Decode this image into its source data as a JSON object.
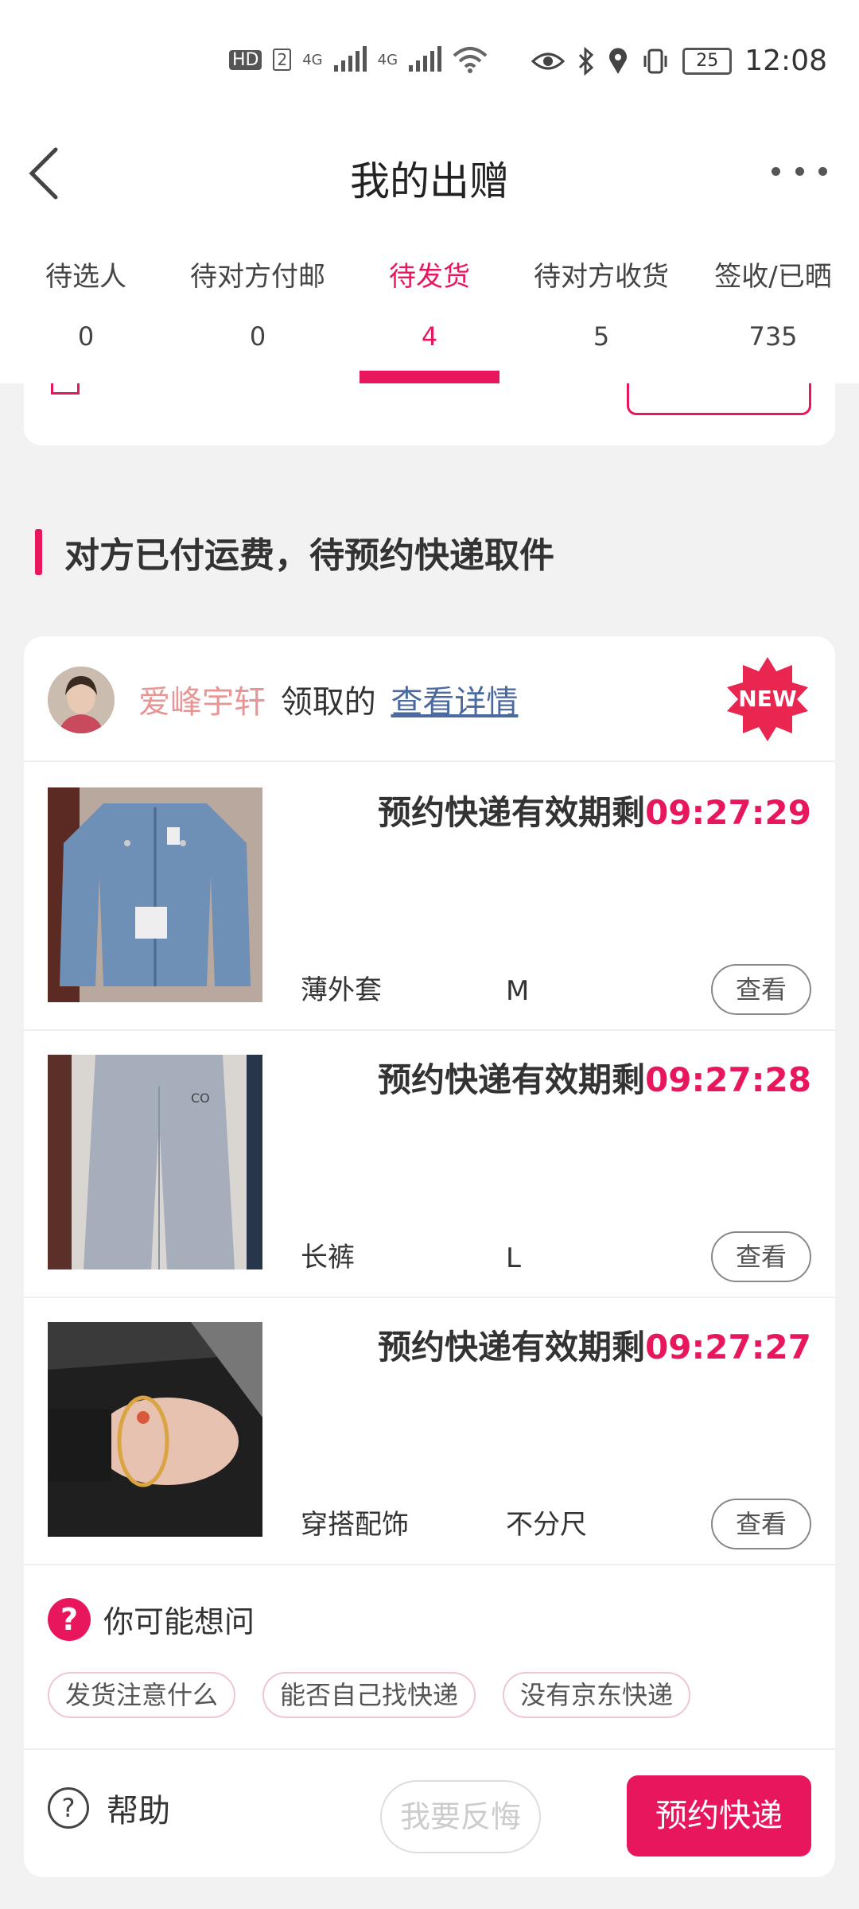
{
  "status_bar": {
    "left_badges": [
      "HD",
      "2",
      "4G",
      "4G"
    ],
    "battery": "25",
    "time": "12:08",
    "icons": [
      "eye-icon",
      "bluetooth-icon",
      "location-icon",
      "vibrate-icon",
      "battery-icon",
      "wifi-icon",
      "signal-icon"
    ]
  },
  "header": {
    "title": "我的出赠"
  },
  "tabs": [
    {
      "label": "待选人",
      "count": "0",
      "active": false
    },
    {
      "label": "待对方付邮",
      "count": "0",
      "active": false
    },
    {
      "label": "待发货",
      "count": "4",
      "active": true
    },
    {
      "label": "待对方收货",
      "count": "5",
      "active": false
    },
    {
      "label": "签收/已晒",
      "count": "735",
      "active": false
    }
  ],
  "section": {
    "title": "对方已付运费，待预约快递取件"
  },
  "claimer": {
    "name": "爱峰宇轩",
    "action": "领取的",
    "detail_link": "查看详情",
    "badge": "NEW"
  },
  "items": [
    {
      "countdown_label": "预约快递有效期剩",
      "countdown_time": "09:27:29",
      "name": "薄外套",
      "size": "M",
      "view_label": "查看"
    },
    {
      "countdown_label": "预约快递有效期剩",
      "countdown_time": "09:27:28",
      "name": "长裤",
      "size": "L",
      "view_label": "查看"
    },
    {
      "countdown_label": "预约快递有效期剩",
      "countdown_time": "09:27:27",
      "name": "穿搭配饰",
      "size": "不分尺",
      "view_label": "查看"
    }
  ],
  "faq": {
    "icon": "?",
    "title": "你可能想问",
    "chips": [
      "发货注意什么",
      "能否自己找快递",
      "没有京东快递"
    ]
  },
  "footer": {
    "help_label": "帮助",
    "regret_label": "我要反悔",
    "book_label": "预约快递"
  },
  "colors": {
    "accent": "#e8175d",
    "name_pink": "#e89595",
    "link_blue": "#4a6aa0"
  }
}
